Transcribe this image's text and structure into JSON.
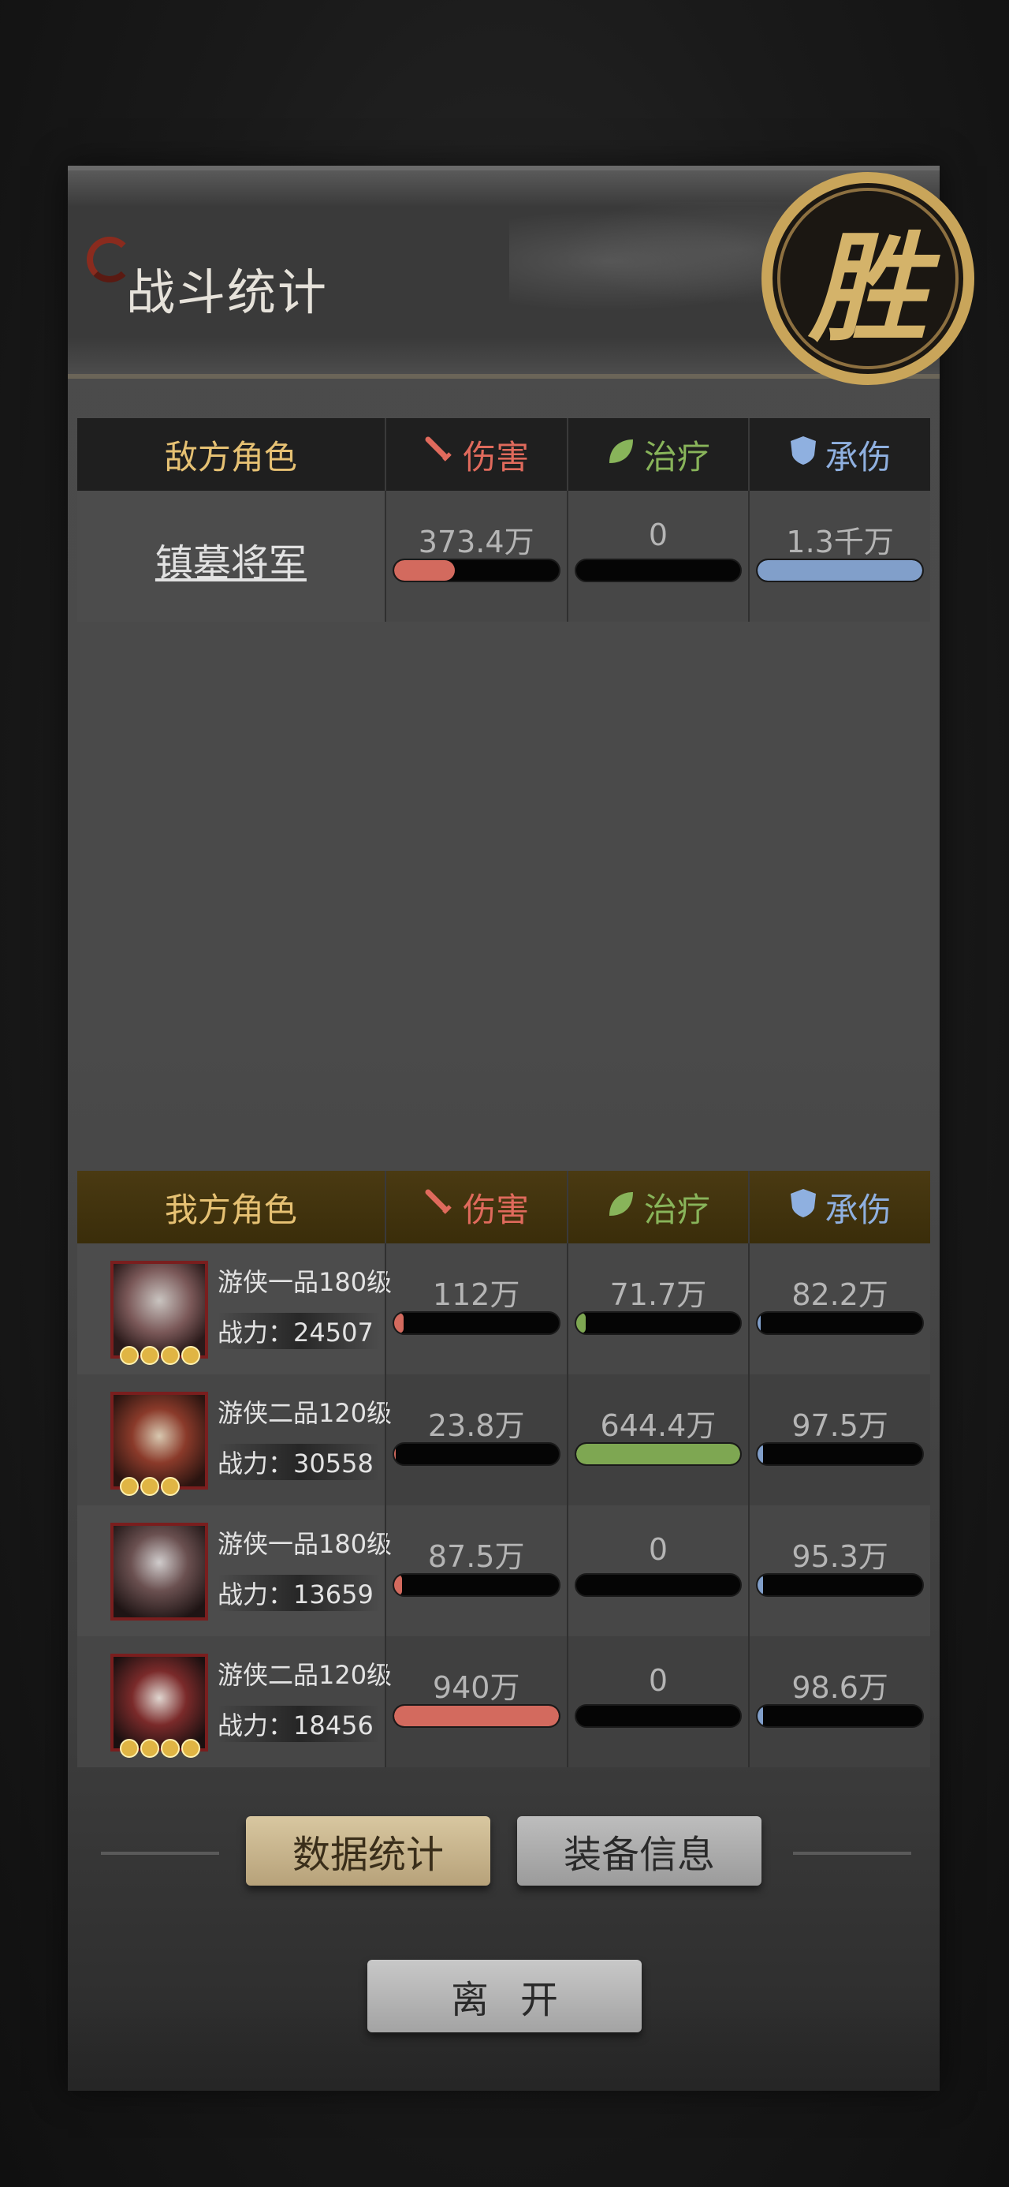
{
  "header": {
    "title": "战斗统计",
    "seal_text": "胜"
  },
  "columns": {
    "damage": "伤害",
    "healing": "治疗",
    "tanking": "承伤"
  },
  "enemy": {
    "heading": "敌方角色",
    "rows": [
      {
        "name": "镇墓将军",
        "damage": "373.4万",
        "healing": "0",
        "tanking": "1.3千万",
        "damage_pct": 37,
        "healing_pct": 0,
        "tanking_pct": 100
      }
    ]
  },
  "ally": {
    "heading": "我方角色",
    "rows": [
      {
        "class": "游侠一品180级",
        "power": "战力：24507",
        "stars": 4,
        "damage": "112万",
        "healing": "71.7万",
        "tanking": "82.2万",
        "damage_pct": 6,
        "healing_pct": 6,
        "tanking_pct": 2
      },
      {
        "class": "游侠二品120级",
        "power": "战力：30558",
        "stars": 3,
        "damage": "23.8万",
        "healing": "644.4万",
        "tanking": "97.5万",
        "damage_pct": 1,
        "healing_pct": 100,
        "tanking_pct": 3
      },
      {
        "class": "游侠一品180级",
        "power": "战力：13659",
        "stars": 0,
        "damage": "87.5万",
        "healing": "0",
        "tanking": "95.3万",
        "damage_pct": 5,
        "healing_pct": 0,
        "tanking_pct": 3
      },
      {
        "class": "游侠二品120级",
        "power": "战力：18456",
        "stars": 4,
        "damage": "940万",
        "healing": "0",
        "tanking": "98.6万",
        "damage_pct": 100,
        "healing_pct": 0,
        "tanking_pct": 3
      }
    ]
  },
  "buttons": {
    "stats": "数据统计",
    "equipment": "装备信息",
    "leave": "离开"
  },
  "colors": {
    "damage": "#d36a5e",
    "healing": "#7ea752",
    "tanking": "#819fca",
    "gold": "#e6c173"
  }
}
